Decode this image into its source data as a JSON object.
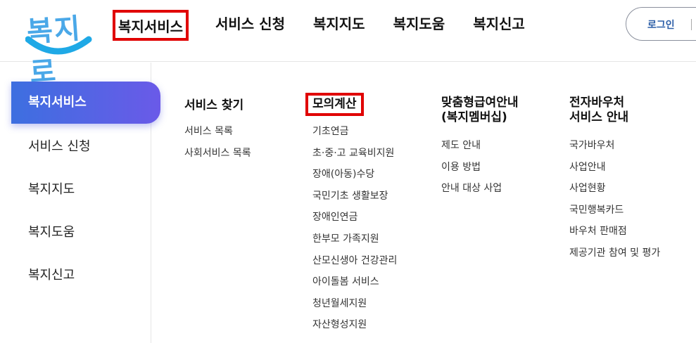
{
  "logo": {
    "text": "복지로"
  },
  "gnb": {
    "items": [
      {
        "label": "복지서비스"
      },
      {
        "label": "서비스 신청"
      },
      {
        "label": "복지지도"
      },
      {
        "label": "복지도움"
      },
      {
        "label": "복지신고"
      }
    ]
  },
  "login": {
    "label": "로그인"
  },
  "side_menu": {
    "items": [
      {
        "label": "복지서비스"
      },
      {
        "label": "서비스 신청"
      },
      {
        "label": "복지지도"
      },
      {
        "label": "복지도움"
      },
      {
        "label": "복지신고"
      }
    ]
  },
  "columns": [
    {
      "title": "서비스 찾기",
      "links": [
        "서비스 목록",
        "사회서비스 목록"
      ]
    },
    {
      "title": "모의계산",
      "links": [
        "기초연금",
        "초·중·고 교육비지원",
        "장애(아동)수당",
        "국민기초 생활보장",
        "장애인연금",
        "한부모 가족지원",
        "산모신생아 건강관리",
        "아이돌봄 서비스",
        "청년월세지원",
        "자산형성지원"
      ]
    },
    {
      "title_line1": "맞춤형급여안내",
      "title_line2": "(복지멤버십)",
      "links": [
        "제도 안내",
        "이용 방법",
        "안내 대상 사업"
      ]
    },
    {
      "title_line1": "전자바우처",
      "title_line2": "서비스 안내",
      "links": [
        "국가바우처",
        "사업안내",
        "사업현황",
        "국민행복카드",
        "바우처 판매점",
        "제공기관 참여 및 평가"
      ]
    }
  ],
  "colors": {
    "highlight_box": "#e00000",
    "side_active_start": "#3d6fe0",
    "side_active_end": "#6a5ae8",
    "logo": "#4aa8e8"
  }
}
